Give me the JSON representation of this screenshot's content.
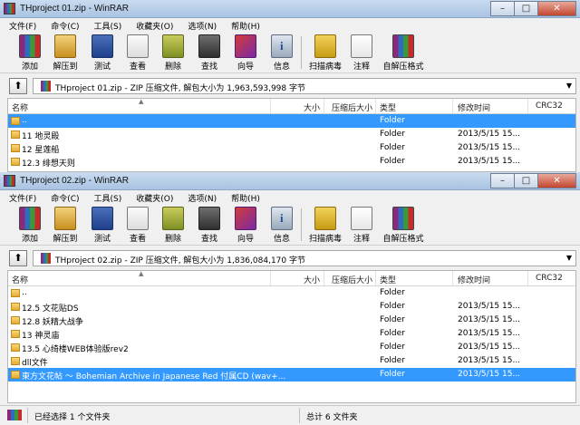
{
  "toolbar_items": [
    {
      "key": "add",
      "label": "添加",
      "icon": "add-archive-icon"
    },
    {
      "key": "extract",
      "label": "解压到",
      "icon": "extract-to-icon"
    },
    {
      "key": "test",
      "label": "测试",
      "icon": "test-icon"
    },
    {
      "key": "view",
      "label": "查看",
      "icon": "view-icon"
    },
    {
      "key": "delete",
      "label": "删除",
      "icon": "delete-icon"
    },
    {
      "key": "find",
      "label": "查找",
      "icon": "find-icon"
    },
    {
      "key": "wizard",
      "label": "向导",
      "icon": "wizard-icon"
    },
    {
      "key": "info",
      "label": "信息",
      "icon": "info-icon"
    },
    {
      "key": "scan",
      "label": "扫描病毒",
      "icon": "virus-scan-icon"
    },
    {
      "key": "comment",
      "label": "注释",
      "icon": "comment-icon"
    },
    {
      "key": "sfx",
      "label": "自解压格式",
      "icon": "sfx-icon"
    }
  ],
  "menu": [
    "文件(F)",
    "命令(C)",
    "工具(S)",
    "收藏夹(O)",
    "选项(N)",
    "帮助(H)"
  ],
  "columns": {
    "name": "名称",
    "size": "大小",
    "packed": "压缩后大小",
    "type": "类型",
    "modified": "修改时间",
    "crc": "CRC32"
  },
  "window1": {
    "title": "THproject 01.zip - WinRAR",
    "path": "THproject 01.zip - ZIP 压缩文件, 解包大小为 1,963,593,998 字节",
    "rows": [
      {
        "name": "..",
        "type": "Folder",
        "modified": "",
        "selected": true
      },
      {
        "name": "11 地灵殿",
        "type": "Folder",
        "modified": "2013/5/15 15..."
      },
      {
        "name": "12 星莲船",
        "type": "Folder",
        "modified": "2013/5/15 15..."
      },
      {
        "name": "12.3 绯想天则",
        "type": "Folder",
        "modified": "2013/5/15 15..."
      }
    ]
  },
  "window2": {
    "title": "THproject 02.zip - WinRAR",
    "path": "THproject 02.zip - ZIP 压缩文件, 解包大小为 1,836,084,170 字节",
    "rows": [
      {
        "name": "..",
        "type": "Folder",
        "modified": ""
      },
      {
        "name": "12.5 文花贴DS",
        "type": "Folder",
        "modified": "2013/5/15 15..."
      },
      {
        "name": "12.8 妖精大战争",
        "type": "Folder",
        "modified": "2013/5/15 15..."
      },
      {
        "name": "13 神灵庙",
        "type": "Folder",
        "modified": "2013/5/15 15..."
      },
      {
        "name": "13.5 心绮楼WEB体验版rev2",
        "type": "Folder",
        "modified": "2013/5/15 15..."
      },
      {
        "name": "dll文件",
        "type": "Folder",
        "modified": "2013/5/15 15..."
      },
      {
        "name": "東方文花帖 ～ Bohemian Archive in Japanese Red 付属CD (wav+...",
        "type": "Folder",
        "modified": "2013/5/15 15...",
        "selected": true
      }
    ],
    "status_left": "已经选择 1 个文件夹",
    "status_right": "总计 6 文件夹"
  },
  "colors": {
    "selection": "#3399ff",
    "folder": "#e1ac34"
  }
}
